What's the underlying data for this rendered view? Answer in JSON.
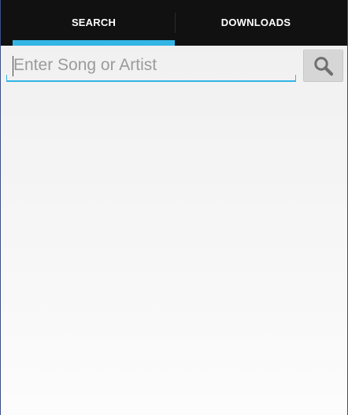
{
  "tabs": {
    "search_label": "SEARCH",
    "downloads_label": "DOWNLOADS",
    "active": "SEARCH"
  },
  "search": {
    "placeholder": "Enter Song or Artist",
    "value": "",
    "button_icon": "search-icon"
  },
  "colors": {
    "tab_bar": "#111111",
    "accent": "#33b5e5",
    "button": "#d6d6d6",
    "background": "#f3f3f3"
  }
}
